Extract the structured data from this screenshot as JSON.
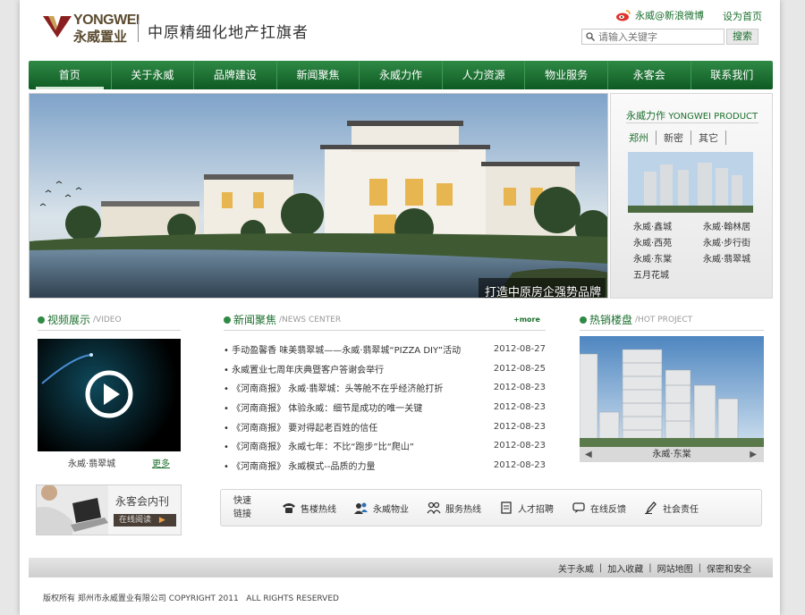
{
  "header": {
    "logo_en": "YONGWEI",
    "logo_cn": "永威置业",
    "slogan": "中原精细化地产扛旗者",
    "weibo_label": "永威@新浪微博",
    "sethome_label": "设为首页",
    "search_placeholder": "请输入关键字",
    "search_button": "搜索"
  },
  "nav": {
    "items": [
      "首页",
      "关于永威",
      "品牌建设",
      "新闻聚焦",
      "永威力作",
      "人力资源",
      "物业服务",
      "永客会",
      "联系我们"
    ]
  },
  "banner": {
    "caption": "打造中原房企强势品牌"
  },
  "product": {
    "title_cn": "永威力作",
    "title_en": "YONGWEI PRODUCT",
    "tabs": [
      "郑州",
      "新密",
      "其它"
    ],
    "list": [
      "永威·鑫城",
      "永威·翰林居",
      "永威·西苑",
      "永威·步行街",
      "永威·东棠",
      "永威·翡翠城",
      "五月花城"
    ]
  },
  "video": {
    "title_cn": "视频展示",
    "title_en": "/VIDEO",
    "caption": "永威·翡翠城",
    "more": "更多"
  },
  "news": {
    "title_cn": "新闻聚焦",
    "title_en": "/NEWS CENTER",
    "more": "+more",
    "items": [
      {
        "title": "• 手动盈馨香 味美翡翠城——永威·翡翠城“PIZZA DIY”活动",
        "date": "2012-08-27"
      },
      {
        "title": "• 永威置业七周年庆典暨客户答谢会举行",
        "date": "2012-08-25"
      },
      {
        "title": "• 《河南商报》 永威·翡翠城：头等舱不在乎经济舱打折",
        "date": "2012-08-23"
      },
      {
        "title": "• 《河南商报》 体验永威：细节是成功的唯一关键",
        "date": "2012-08-23"
      },
      {
        "title": "• 《河南商报》 要对得起老百姓的信任",
        "date": "2012-08-23"
      },
      {
        "title": "• 《河南商报》 永威七年：不比“跑步”比“爬山”",
        "date": "2012-08-23"
      },
      {
        "title": "• 《河南商报》 永威模式--品质的力量",
        "date": "2012-08-23"
      }
    ]
  },
  "hot": {
    "title_cn": "热销楼盘",
    "title_en": "/HOT PROJECT",
    "caption": "永威·东棠"
  },
  "magazine": {
    "title": "永客会内刊",
    "button": "在线阅读"
  },
  "quick": {
    "label_line1": "快速",
    "label_line2": "链接",
    "items": [
      {
        "label": "售楼热线",
        "icon": "phone-icon"
      },
      {
        "label": "永威物业",
        "icon": "people-icon"
      },
      {
        "label": "服务热线",
        "icon": "service-icon"
      },
      {
        "label": "人才招聘",
        "icon": "document-icon"
      },
      {
        "label": "在线反馈",
        "icon": "chat-icon"
      },
      {
        "label": "社会责任",
        "icon": "pen-icon"
      }
    ]
  },
  "footer": {
    "links": [
      "关于永威",
      "加入收藏",
      "网站地图",
      "保密和安全"
    ],
    "copyright": "版权所有 郑州市永威置业有限公司 COPYRIGHT 2011   ALL RIGHTS RESERVED"
  }
}
